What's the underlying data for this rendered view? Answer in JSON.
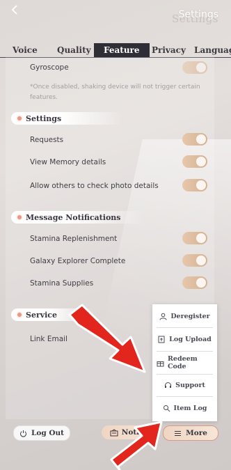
{
  "header": {
    "title": "Settings",
    "back_icon": "back-arrow-icon"
  },
  "tabs": [
    {
      "label": "Voice"
    },
    {
      "label": "Quality"
    },
    {
      "label": "Feature",
      "active": true
    },
    {
      "label": "Privacy"
    },
    {
      "label": "Languag"
    }
  ],
  "feature": {
    "gyroscope_label": "Gyroscope",
    "gyroscope_note": "*Once disabled, shaking device will not trigger certain features."
  },
  "sections": {
    "settings": {
      "title": "Settings",
      "items": [
        {
          "label": "Requests",
          "on": true
        },
        {
          "label": "View Memory details",
          "on": true
        },
        {
          "label": "Allow others to check photo details",
          "on": true
        }
      ]
    },
    "message_notifications": {
      "title": "Message Notifications",
      "items": [
        {
          "label": "Stamina Replenishment",
          "on": true
        },
        {
          "label": "Galaxy Explorer Complete",
          "on": true
        },
        {
          "label": "Stamina Supplies",
          "on": true
        }
      ]
    },
    "service": {
      "title": "Service",
      "link_email_label": "Link Email"
    }
  },
  "more_menu": {
    "items": [
      {
        "label": "Deregister",
        "icon": "user-icon"
      },
      {
        "label": "Log Upload",
        "icon": "upload-icon"
      },
      {
        "label": "Redeem Code",
        "icon": "gift-icon"
      },
      {
        "label": "Support",
        "icon": "headset-icon"
      },
      {
        "label": "Item Log",
        "icon": "search-icon"
      }
    ]
  },
  "bottom_bar": {
    "logout_label": "Log Out",
    "notice_label": "Notice",
    "more_label": "More"
  },
  "colors": {
    "accent_toggle": "#d7b08f",
    "active_tab_bg": "#2f2d36",
    "arrow_red": "#e2261d"
  }
}
